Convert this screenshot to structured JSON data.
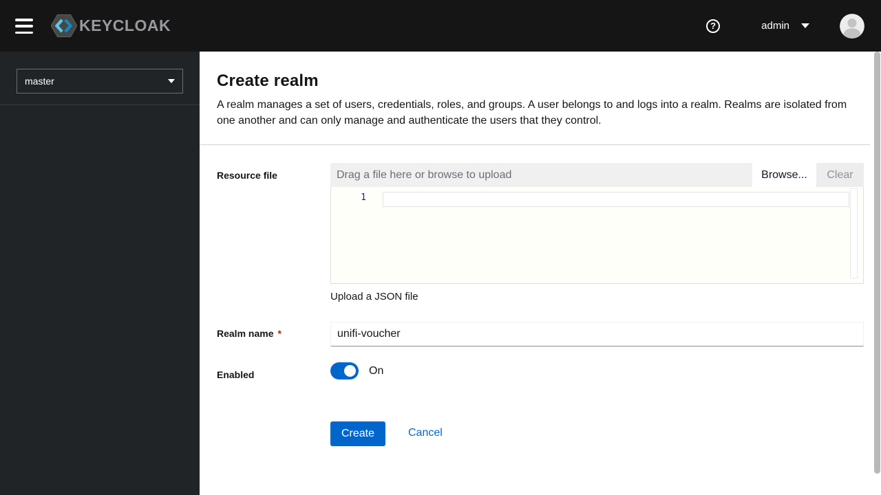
{
  "header": {
    "brand_text": "KEYCLOAK",
    "help_glyph": "?",
    "user_label": "admin"
  },
  "sidebar": {
    "realm_selector_value": "master"
  },
  "page": {
    "title": "Create realm",
    "description": "A realm manages a set of users, credentials, roles, and groups. A user belongs to and logs into a realm. Realms are isolated from one another and can only manage and authenticate the users that they control."
  },
  "form": {
    "resource_file": {
      "label": "Resource file",
      "placeholder": "Drag a file here or browse to upload",
      "browse_label": "Browse...",
      "clear_label": "Clear",
      "line_number": "1",
      "helper_text": "Upload a JSON file"
    },
    "realm_name": {
      "label": "Realm name",
      "required_indicator": "*",
      "value": "unifi-voucher"
    },
    "enabled": {
      "label": "Enabled",
      "state_label": "On"
    },
    "actions": {
      "create": "Create",
      "cancel": "Cancel"
    }
  },
  "colors": {
    "primary_blue": "#0066cc",
    "masthead_bg": "#151515",
    "sidebar_bg": "#212427",
    "divider_gray": "#d2d2d2",
    "required_red": "#c9190b",
    "logo_cyan_light": "#5bc7e8",
    "logo_cyan_dark": "#1489bd"
  }
}
